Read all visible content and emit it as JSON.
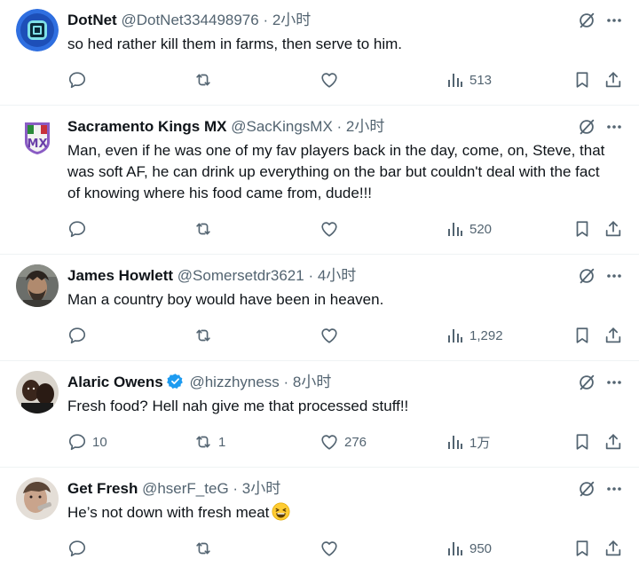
{
  "tweets": [
    {
      "name": "DotNet",
      "handle": "@DotNet334498976",
      "time": "· 2小时",
      "text": "so hed rather kill them in farms, then serve to him.",
      "replies": "",
      "retweets": "",
      "likes": "",
      "views": "513"
    },
    {
      "name": "Sacramento Kings MX",
      "handle": "@SacKingsMX",
      "time": "· 2小时",
      "text": "Man, even if he was one of my fav players back in the day, come, on, Steve, that was soft AF, he can drink up everything on the bar but couldn't deal with the fact of knowing where his food came from, dude!!!",
      "replies": "",
      "retweets": "",
      "likes": "",
      "views": "520"
    },
    {
      "name": "James Howlett",
      "handle": "@Somersetdr3621",
      "time": "· 4小时",
      "text": "Man a country boy would have been in heaven.",
      "replies": "",
      "retweets": "",
      "likes": "",
      "views": "1,292"
    },
    {
      "name": "Alaric Owens",
      "handle": "@hizzhyness",
      "time": "· 8小时",
      "text": "Fresh food? Hell nah give me that processed stuff!!",
      "replies": "10",
      "retweets": "1",
      "likes": "276",
      "views": "1万"
    },
    {
      "name": "Get Fresh",
      "handle": "@hserF_teG",
      "time": "· 3小时",
      "text": "He’s not down with fresh meat",
      "replies": "",
      "retweets": "",
      "likes": "",
      "views": "950"
    }
  ],
  "colors": {
    "text": "#0f1419",
    "muted": "#536471",
    "verified": "#1d9bf0",
    "divider": "#eff3f4"
  },
  "icons": [
    "grok-icon",
    "more-icon",
    "reply-icon",
    "retweet-icon",
    "like-icon",
    "views-icon",
    "bookmark-icon",
    "share-icon",
    "verified-badge-icon",
    "grinning-squinting-emoji"
  ]
}
